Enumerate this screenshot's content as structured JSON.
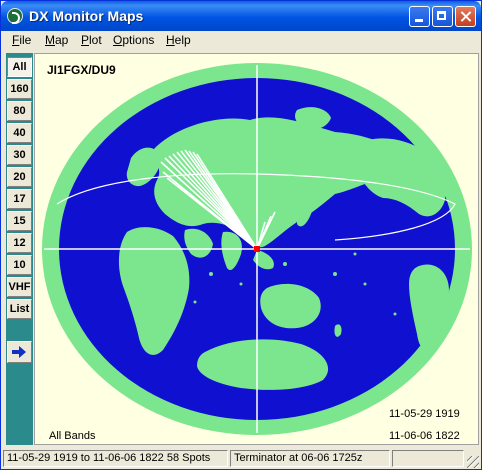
{
  "window": {
    "title": "DX Monitor Maps"
  },
  "menu": [
    {
      "key": "F",
      "rest": "ile"
    },
    {
      "key": "M",
      "rest": "ap"
    },
    {
      "key": "P",
      "rest": "lot"
    },
    {
      "key": "O",
      "rest": "ptions"
    },
    {
      "key": "H",
      "rest": "elp"
    }
  ],
  "bands": [
    "All",
    "160",
    "80",
    "40",
    "30",
    "20",
    "17",
    "15",
    "12",
    "10",
    "VHF",
    "List"
  ],
  "selected_band": "All",
  "map": {
    "callsign": "JI1FGX/DU9",
    "bands_label": "All Bands",
    "date_from": "11-05-29 1919",
    "date_to": "11-06-06 1822",
    "colors": {
      "ocean": "#1010D0",
      "land": "#7CE68E",
      "background": "#FFFFE1",
      "spots": "#FFFFFF",
      "center": "#FF0000",
      "grid": "#FFFFFF"
    }
  },
  "status": {
    "range": "11-05-29 1919 to 11-06-06 1822 58 Spots",
    "terminator": "Terminator at 06-06 1725z",
    "extra": ""
  }
}
